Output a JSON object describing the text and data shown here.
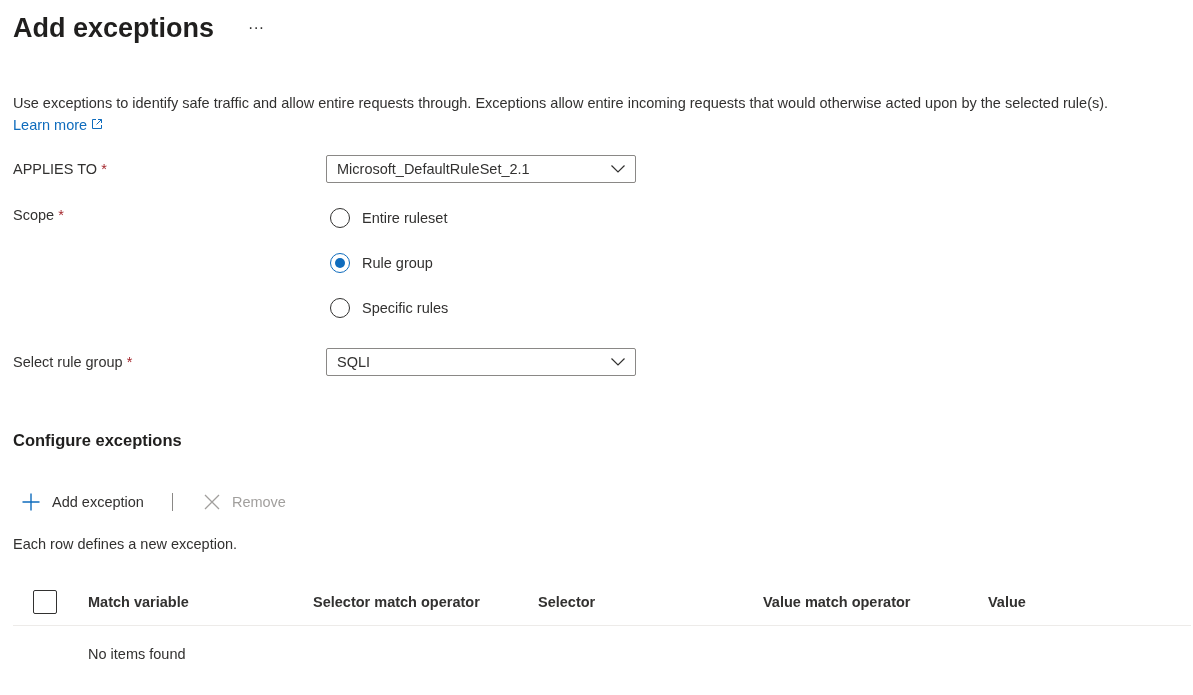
{
  "header": {
    "title": "Add exceptions",
    "more": "···"
  },
  "description": {
    "text": "Use exceptions to identify safe traffic and allow entire requests through. Exceptions allow entire incoming requests that would otherwise acted upon by the selected rule(s).",
    "link": "Learn more"
  },
  "applies_to": {
    "label": "APPLIES TO",
    "required_mark": "*",
    "value": "Microsoft_DefaultRuleSet_2.1"
  },
  "scope": {
    "label": "Scope",
    "required_mark": "*",
    "options": [
      {
        "label": "Entire ruleset",
        "selected": false
      },
      {
        "label": "Rule group",
        "selected": true
      },
      {
        "label": "Specific rules",
        "selected": false
      }
    ]
  },
  "rule_group": {
    "label": "Select rule group",
    "required_mark": "*",
    "value": "SQLI"
  },
  "section_title": "Configure exceptions",
  "toolbar": [
    {
      "kind": "add",
      "label": "Add exception",
      "disabled": false
    },
    {
      "kind": "remove",
      "label": "Remove",
      "disabled": true
    }
  ],
  "hint": "Each row defines a new exception.",
  "table": {
    "select_all_checked": false,
    "columns": [
      "Match variable",
      "Selector match operator",
      "Selector",
      "Value match operator",
      "Value"
    ],
    "empty_text": "No items found"
  }
}
